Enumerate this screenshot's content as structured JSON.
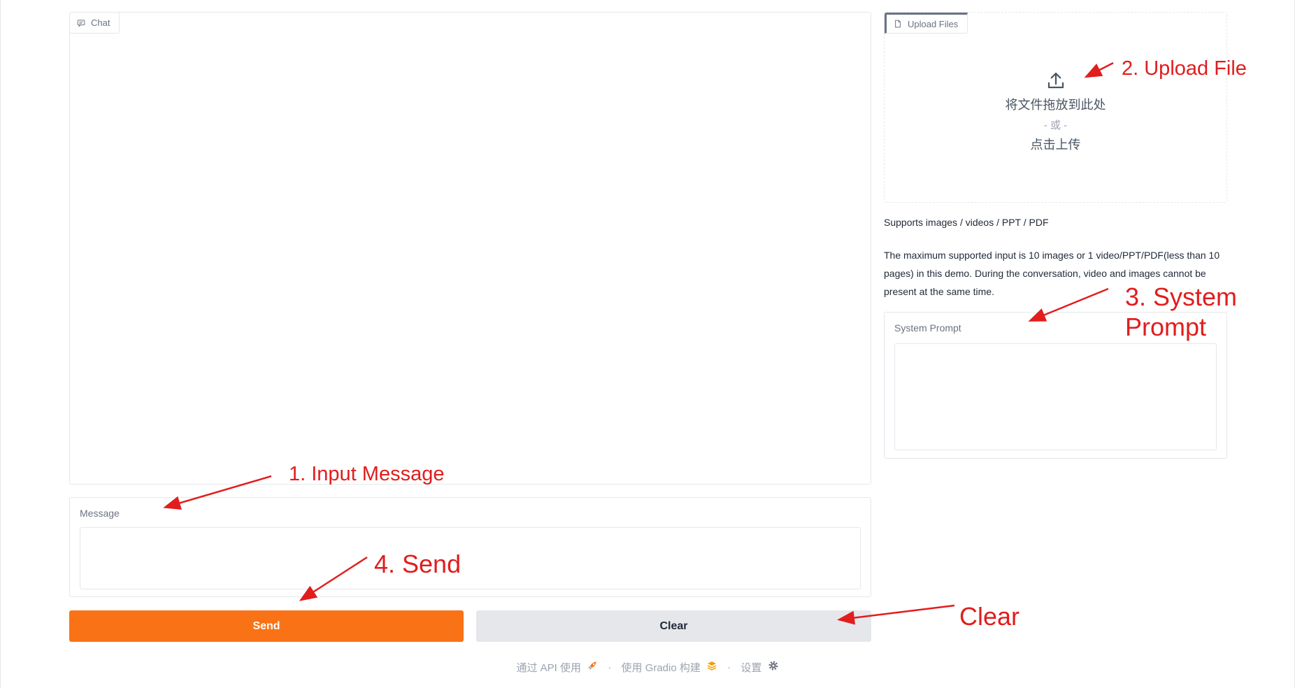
{
  "chat": {
    "label": "Chat"
  },
  "message": {
    "label": "Message",
    "value": "",
    "placeholder": ""
  },
  "buttons": {
    "send": "Send",
    "clear": "Clear"
  },
  "upload": {
    "label": "Upload Files",
    "drop_text": "将文件拖放到此处",
    "or_text": "- 或 -",
    "click_text": "点击上传"
  },
  "info": {
    "supports": "Supports images / videos / PPT / PDF",
    "max_input": "The maximum supported input is 10 images or 1 video/PPT/PDF(less than 10 pages) in this demo. During the conversation, video and images cannot be present at the same time."
  },
  "system_prompt": {
    "label": "System Prompt",
    "value": "",
    "placeholder": ""
  },
  "footer": {
    "api": "通过 API 使用",
    "built": "使用 Gradio 构建",
    "settings": "设置"
  },
  "annotations": {
    "input_message": "1. Input Message",
    "upload_file": "2. Upload File",
    "system_prompt_line1": "3. System",
    "system_prompt_line2": "Prompt",
    "send": "4. Send",
    "clear": "Clear"
  },
  "colors": {
    "accent": "#f97316",
    "annotation": "#e11d1d",
    "secondary_button": "#e5e7eb"
  },
  "icons": {
    "chat": "chat-bubble-icon",
    "upload_label": "file-icon",
    "upload": "upload-arrow-icon",
    "api": "rocket-icon",
    "gradio": "gradio-logo-icon",
    "settings": "gear-icon"
  }
}
